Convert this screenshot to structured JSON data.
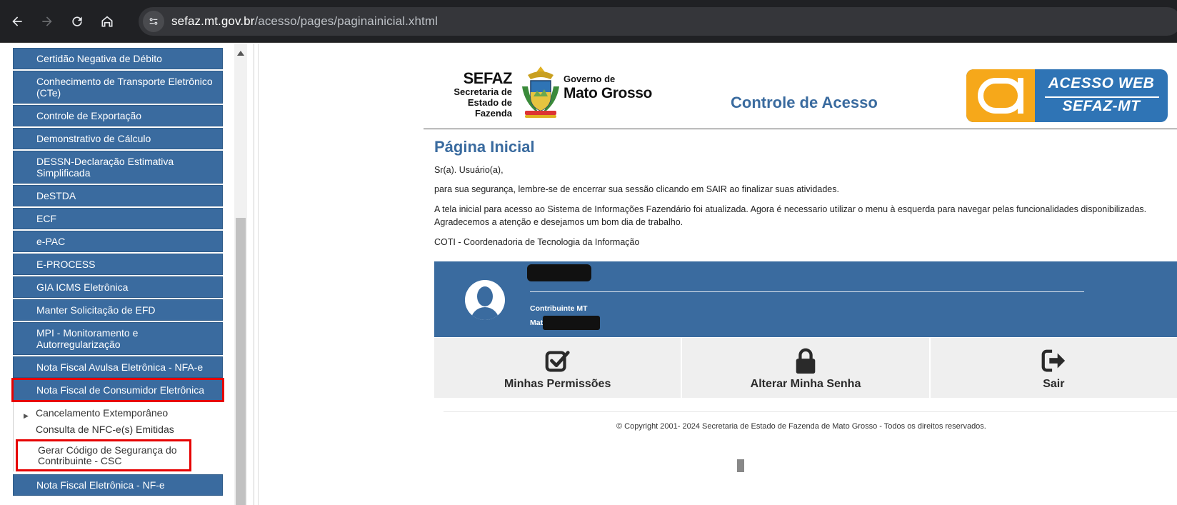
{
  "browser": {
    "url_domain": "sefaz.mt.gov.br",
    "url_path": "/acesso/pages/paginainicial.xhtml"
  },
  "sidebar": {
    "items": [
      {
        "label": "Certidão Negativa de Débito",
        "lines": 1
      },
      {
        "label": "Conhecimento de Transporte Eletrônico (CTe)",
        "lines": 2
      },
      {
        "label": "Controle de Exportação",
        "lines": 1
      },
      {
        "label": "Demonstrativo de Cálculo",
        "lines": 1
      },
      {
        "label": "DESSN-Declaração Estimativa Simplificada",
        "lines": 2
      },
      {
        "label": "DeSTDA",
        "lines": 1
      },
      {
        "label": "ECF",
        "lines": 1
      },
      {
        "label": "e-PAC",
        "lines": 1
      },
      {
        "label": "E-PROCESS",
        "lines": 1
      },
      {
        "label": "GIA ICMS Eletrônica",
        "lines": 1
      },
      {
        "label": "Manter Solicitação de EFD",
        "lines": 1
      },
      {
        "label": "MPI - Monitoramento e Autorregularização",
        "lines": 2
      },
      {
        "label": "Nota Fiscal Avulsa Eletrônica - NFA-e",
        "lines": 1
      },
      {
        "label": "Nota Fiscal de Consumidor Eletrônica",
        "lines": 1
      }
    ],
    "submenu": [
      "Cancelamento Extemporâneo",
      "Consulta de NFC-e(s) Emitidas",
      "Gerar Código de Segurança do Contribuinte - CSC"
    ],
    "after_item": "Nota Fiscal Eletrônica - NF-e"
  },
  "header": {
    "logo_sefaz": "SEFAZ",
    "logo_secretaria": "Secretaria de",
    "logo_estado": "Estado de Fazenda",
    "logo_governo": "Governo de",
    "logo_mato_grosso": "Mato Grosso",
    "title": "Controle de Acesso",
    "acesso_line1": "ACESSO WEB",
    "acesso_line2": "SEFAZ-MT"
  },
  "content": {
    "page_title": "Página Inicial",
    "greeting": "Sr(a). Usuário(a),",
    "p1": "para sua segurança, lembre-se de encerrar sua sessão clicando em SAIR ao finalizar suas atividades.",
    "p2": "A tela inicial para acesso ao Sistema de Informações Fazendário foi atualizada. Agora é necessario utilizar o menu à esquerda para navegar pelas funcionalidades disponibilizadas. Agradecemos a atenção e desejamos um bom dia de trabalho.",
    "p3": "COTI - Coordenadoria de Tecnologia da Informação"
  },
  "user": {
    "role": "Contribuinte MT",
    "mat_prefix": "Mat"
  },
  "actions": {
    "permissions": "Minhas Permissões",
    "change_password": "Alterar Minha Senha",
    "logout": "Sair"
  },
  "footer": {
    "copyright": "© Copyright 2001- 2024 Secretaria de Estado de Fazenda de Mato Grosso - Todos os direitos reservados."
  },
  "colors": {
    "brand_blue": "#3a6b9f",
    "highlight_red": "#e60000",
    "acesso_orange": "#f6a81a"
  }
}
